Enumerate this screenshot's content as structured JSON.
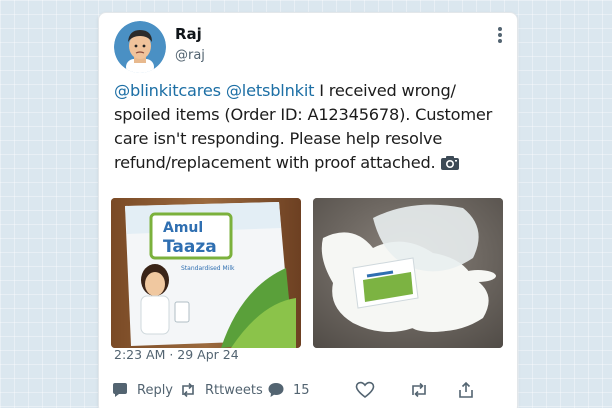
{
  "user": {
    "name": "Raj",
    "handle": "@raj"
  },
  "tweet": {
    "mention_1": "@blinkitcares",
    "mention_2": "@letsblnkit",
    "text_line_1": "  I received wrong/",
    "text_line_2": "spoiled items (Order ID: A12345678). Customer",
    "text_line_3": "care isn't responding. Please help resolve",
    "text_line_4": "refund/replacement with proof attached. "
  },
  "photos": {
    "photo_1": {
      "brand_text_1": "Amul",
      "brand_text_2": "Taaza",
      "sub_text": "Standardised Milk"
    }
  },
  "timestamp": "2:23 AM · 29 Apr 24",
  "actions": {
    "reply_label": "Reply",
    "retweets_label": "Rttweets",
    "likes_count": "15"
  },
  "icons": {
    "reply": "comment-bubble-icon",
    "retweet": "retweet-icon",
    "likes": "speech-bubble-icon",
    "heart": "heart-icon",
    "share": "share-icon",
    "more": "more-vertical-icon",
    "camera": "camera-icon"
  },
  "colors": {
    "mention": "#1d6fa5",
    "secondary": "#536471",
    "background": "#dbe7ef"
  }
}
